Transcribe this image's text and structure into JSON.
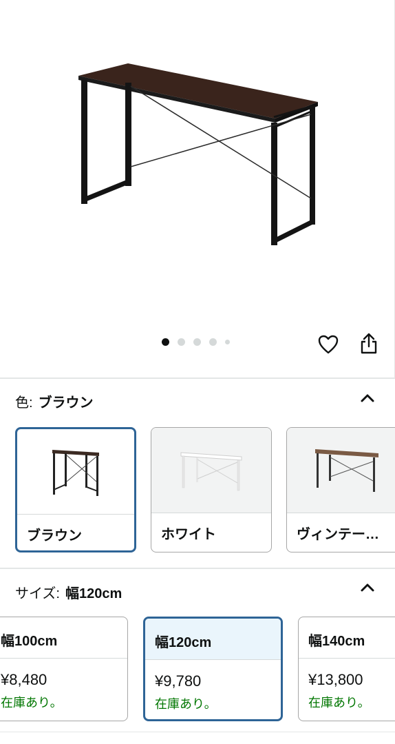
{
  "gallery": {
    "image_alt": "desk",
    "dots": [
      true,
      false,
      false,
      false,
      false
    ]
  },
  "color_section": {
    "label": "色:",
    "value": "ブラウン",
    "options": [
      {
        "name": "ブラウン",
        "selected": true,
        "top_color": "#3b2a22"
      },
      {
        "name": "ホワイト",
        "selected": false,
        "top_color": "#ffffff"
      },
      {
        "name": "ヴィンテー…",
        "selected": false,
        "top_color": "#7a5a44"
      }
    ]
  },
  "size_section": {
    "label": "サイズ:",
    "value": "幅120cm",
    "options": [
      {
        "size": "幅100cm",
        "price": "¥8,480",
        "stock": "在庫あり。",
        "selected": false
      },
      {
        "size": "幅120cm",
        "price": "¥9,780",
        "stock": "在庫あり。",
        "selected": true
      },
      {
        "size": "幅140cm",
        "price": "¥13,800",
        "stock": "在庫あり。",
        "selected": false
      }
    ]
  },
  "colors": {
    "selected_border": "#2e6496",
    "selected_bg": "#eaf5fc",
    "in_stock": "#007600"
  }
}
